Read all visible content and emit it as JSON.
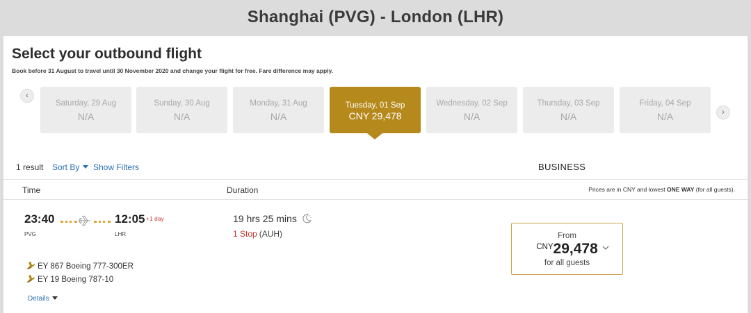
{
  "route_title": "Shanghai (PVG) - London (LHR)",
  "heading": "Select your outbound flight",
  "subnote": "Book before 31 August to travel until 30 November 2020 and change your flight for free. Fare difference may apply.",
  "date_nav": {
    "prev_icon": "chevron-left-icon",
    "next_icon": "chevron-right-icon",
    "prev_glyph": "‹",
    "next_glyph": "›",
    "dates": [
      {
        "date": "Saturday, 29 Aug",
        "price": "N/A",
        "selected": false
      },
      {
        "date": "Sunday, 30 Aug",
        "price": "N/A",
        "selected": false
      },
      {
        "date": "Monday, 31 Aug",
        "price": "N/A",
        "selected": false
      },
      {
        "date": "Tuesday, 01 Sep",
        "price": "CNY 29,478",
        "selected": true
      },
      {
        "date": "Wednesday, 02 Sep",
        "price": "N/A",
        "selected": false
      },
      {
        "date": "Thursday, 03 Sep",
        "price": "N/A",
        "selected": false
      },
      {
        "date": "Friday, 04 Sep",
        "price": "N/A",
        "selected": false
      }
    ]
  },
  "toolbar": {
    "result_count": "1 result",
    "sort_label": "Sort By",
    "filters_label": "Show Filters",
    "cabin": "BUSINESS"
  },
  "columns": {
    "time": "Time",
    "duration": "Duration",
    "note_prefix": "Prices are in CNY and lowest ",
    "note_bold": "ONE WAY",
    "note_suffix": " (for all guests)."
  },
  "flight": {
    "depart_time": "23:40",
    "arrive_time": "12:05",
    "plus_day": "+1 day",
    "depart_code": "PVG",
    "arrive_code": "LHR",
    "duration": "19 hrs 25 mins",
    "overnight_icon": "moon-icon",
    "stops": "1 Stop",
    "via": "(AUH)",
    "legs": [
      {
        "flight": "EY 867",
        "aircraft": "Boeing 777-300ER"
      },
      {
        "flight": "EY 19",
        "aircraft": "Boeing 787-10"
      }
    ],
    "details_label": "Details"
  },
  "fare": {
    "from": "From",
    "currency": "CNY",
    "amount": "29,478",
    "guests": "for all guests"
  },
  "colors": {
    "accent_gold": "#b5891b",
    "link_blue": "#2a6fb5",
    "alert_red": "#c0392b"
  }
}
